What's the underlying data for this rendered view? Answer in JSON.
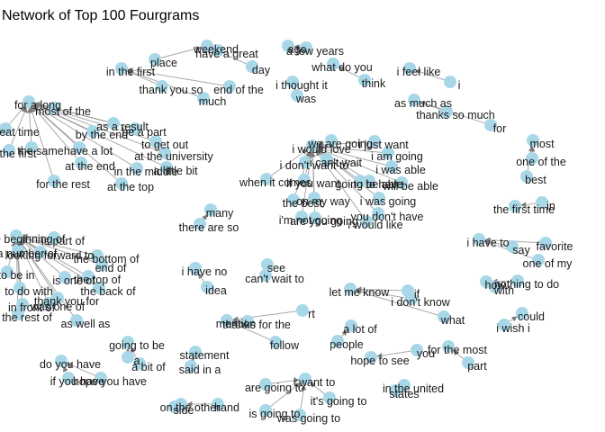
{
  "chart_data": {
    "type": "network",
    "title": "Network of Top 100 Fourgrams",
    "node_color": "#a8d8e8",
    "edge_color": "#8c8c8c",
    "clusters": [
      {
        "words": [
          "weekend",
          "have a great",
          "day",
          "place"
        ]
      },
      {
        "words": [
          "ago",
          "a few years"
        ]
      },
      {
        "words": [
          "what do you",
          "think"
        ]
      },
      {
        "words": [
          "i feel like",
          "i"
        ]
      },
      {
        "words": [
          "in the first",
          "thank you so",
          "end of the",
          "much"
        ]
      },
      {
        "words": [
          "i thought it",
          "was"
        ]
      },
      {
        "words": [
          "as much as",
          "thanks so much",
          "for"
        ]
      },
      {
        "words": [
          "for a long",
          "most of the",
          "great time",
          "the first",
          "as a result",
          "be a part",
          "by the end",
          "the same",
          "have a lot",
          "to get out",
          "at the university",
          "a little bit",
          "at the end",
          "in the middle",
          "for the rest",
          "at the top"
        ]
      },
      {
        "words": [
          "most",
          "one of the",
          "best"
        ]
      },
      {
        "words": [
          "i would love",
          "we are going",
          "i just want",
          "i don't want to",
          "i can't wait",
          "i am going",
          "when it comes",
          "i was able",
          "if you want",
          "to be able",
          "will be able",
          "on my way",
          "the best",
          "going to have",
          "i was going",
          "you don't have",
          "i'm not going",
          "are you going",
          "i would like"
        ]
      },
      {
        "words": [
          "the first time",
          "in"
        ]
      },
      {
        "words": [
          "many",
          "there are so"
        ]
      },
      {
        "words": [
          "i have to",
          "say",
          "favorite",
          "one of my"
        ]
      },
      {
        "words": [
          "the beginning of",
          "is part of",
          "a number of",
          "looking forward to",
          "the bottom of",
          "end of",
          "to be in",
          "the top of",
          "to do with",
          "is one of",
          "the back of",
          "thank you for",
          "in front of",
          "was one of",
          "the rest of",
          "as well as"
        ]
      },
      {
        "words": [
          "i have no",
          "idea"
        ]
      },
      {
        "words": [
          "see",
          "can't wait to"
        ]
      },
      {
        "words": [
          "let me know",
          "if",
          "i don't know",
          "what"
        ]
      },
      {
        "words": [
          "how",
          "nothing to do",
          "with"
        ]
      },
      {
        "words": [
          "mention",
          "thanks for the",
          "rt",
          "follow"
        ]
      },
      {
        "words": [
          "could",
          "i wish i"
        ]
      },
      {
        "words": [
          "a lot of",
          "people"
        ]
      },
      {
        "words": [
          "going to be",
          "a",
          "a bit of"
        ]
      },
      {
        "words": [
          "statement",
          "said in a"
        ]
      },
      {
        "words": [
          "do you have",
          "if you have",
          "hope you have"
        ]
      },
      {
        "words": [
          "hope to see",
          "you"
        ]
      },
      {
        "words": [
          "for the most",
          "part"
        ]
      },
      {
        "words": [
          "i want to",
          "it's going to",
          "are going to",
          "is going to",
          "was going to"
        ]
      },
      {
        "words": [
          "in the united",
          "states"
        ]
      },
      {
        "words": [
          "on the other",
          "side",
          "hand"
        ]
      }
    ]
  }
}
